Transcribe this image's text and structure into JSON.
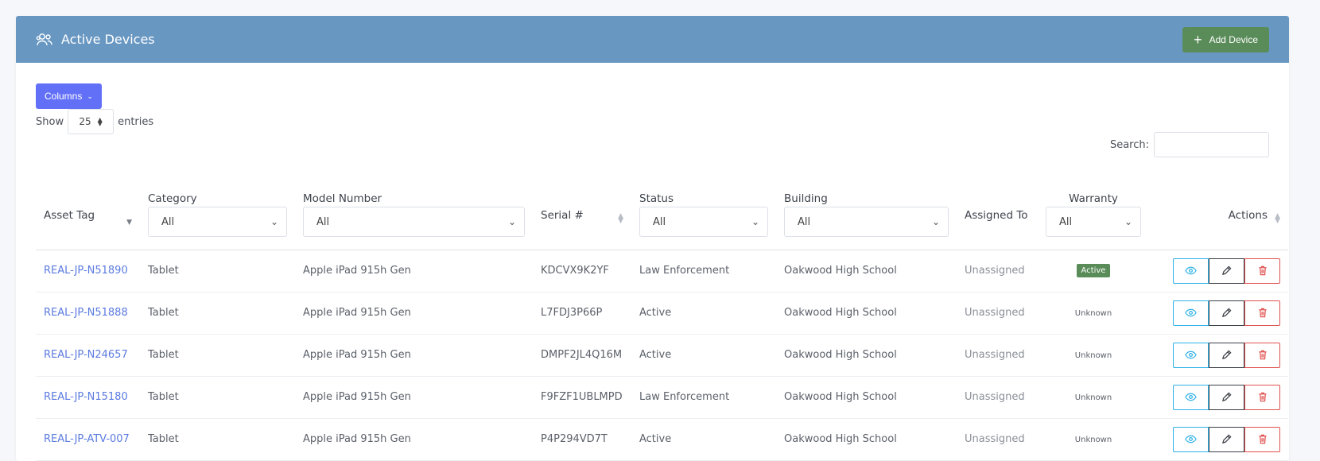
{
  "header": {
    "title": "Active Devices",
    "add_button": "Add Device"
  },
  "toolbar": {
    "columns_label": "Columns",
    "show_label": "Show",
    "entries_value": "25",
    "entries_label": "entries",
    "search_label": "Search:",
    "search_value": ""
  },
  "table": {
    "columns": {
      "asset_tag": "Asset Tag",
      "category": "Category",
      "model_number": "Model Number",
      "serial": "Serial #",
      "status": "Status",
      "building": "Building",
      "assigned_to": "Assigned To",
      "warranty": "Warranty",
      "actions": "Actions"
    },
    "filters": {
      "category": "All",
      "model_number": "All",
      "status": "All",
      "building": "All",
      "warranty": "All"
    },
    "rows": [
      {
        "asset_tag": "REAL-JP-N51890",
        "category": "Tablet",
        "model": "Apple iPad 915h Gen",
        "serial": "KDCVX9K2YF",
        "status": "Law Enforcement",
        "building": "Oakwood High School",
        "assigned": "Unassigned",
        "warranty": "Active"
      },
      {
        "asset_tag": "REAL-JP-N51888",
        "category": "Tablet",
        "model": "Apple iPad 915h Gen",
        "serial": "L7FDJ3P66P",
        "status": "Active",
        "building": "Oakwood High School",
        "assigned": "Unassigned",
        "warranty": "Unknown"
      },
      {
        "asset_tag": "REAL-JP-N24657",
        "category": "Tablet",
        "model": "Apple iPad 915h Gen",
        "serial": "DMPF2JL4Q16M",
        "status": "Active",
        "building": "Oakwood High School",
        "assigned": "Unassigned",
        "warranty": "Unknown"
      },
      {
        "asset_tag": "REAL-JP-N15180",
        "category": "Tablet",
        "model": "Apple iPad 915h Gen",
        "serial": "F9FZF1UBLMPD",
        "status": "Law Enforcement",
        "building": "Oakwood High School",
        "assigned": "Unassigned",
        "warranty": "Unknown"
      },
      {
        "asset_tag": "REAL-JP-ATV-007",
        "category": "Tablet",
        "model": "Apple iPad 915h Gen",
        "serial": "P4P294VD7T",
        "status": "Active",
        "building": "Oakwood High School",
        "assigned": "Unassigned",
        "warranty": "Unknown"
      }
    ]
  },
  "colors": {
    "header_bg": "#6897c2",
    "add_button_bg": "#5a8c5a",
    "columns_button_bg": "#6270f7",
    "link": "#5b7be0",
    "view_border": "#2fb1e8",
    "edit_border": "#3b3f46",
    "delete_border": "#e0524f",
    "badge_active": "#5a8c5a"
  },
  "icons": {
    "header": "users-icon",
    "add": "plus-icon",
    "view": "eye-icon",
    "edit": "pencil-icon",
    "delete": "trash-icon"
  }
}
